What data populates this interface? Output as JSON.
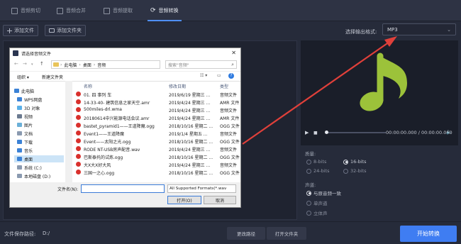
{
  "tabs": [
    {
      "label": "音频剪切",
      "icon": "scissors-icon"
    },
    {
      "label": "音频合并",
      "icon": "merge-icon"
    },
    {
      "label": "音频提取",
      "icon": "extract-icon"
    },
    {
      "label": "音频转换",
      "icon": "convert-icon",
      "active": true
    }
  ],
  "toolbar": {
    "add_file": "添加文件",
    "add_folder": "添加文件夹",
    "format_label": "选择输出格式:",
    "format_value": "MP3"
  },
  "player": {
    "time": "00:00:00.000 / 00:00:00.000",
    "accent": "#9cc23a"
  },
  "settings": {
    "quality_title": "质量:",
    "quality_options": [
      {
        "label": "8-bits",
        "selected": false
      },
      {
        "label": "16-bits",
        "selected": true
      },
      {
        "label": "24-bits",
        "selected": false
      },
      {
        "label": "32-bits",
        "selected": false
      }
    ],
    "channel_title": "声道:",
    "channel_options": [
      {
        "label": "与原音频一致",
        "selected": true
      },
      {
        "label": "单声道",
        "selected": false
      },
      {
        "label": "立体声",
        "selected": false
      }
    ]
  },
  "bottom": {
    "save_label": "文件保存路径:",
    "save_path": "D:/",
    "change_path": "更改路径",
    "open_folder": "打开文件夹",
    "start": "开始转换",
    "start_color": "#3f7df2"
  },
  "dialog": {
    "title": "请选择音频文件",
    "address": [
      "此电脑",
      "桌面",
      "音频"
    ],
    "search_placeholder": "搜索\"音频\"",
    "organize": "组织 ▾",
    "new_folder": "新建文件夹",
    "tree": [
      {
        "label": "此电脑",
        "icon": "pc-icon"
      },
      {
        "label": "WPS网盘",
        "icon": "cloud-icon"
      },
      {
        "label": "3D 对象",
        "icon": "cube-icon"
      },
      {
        "label": "视频",
        "icon": "video-icon"
      },
      {
        "label": "图片",
        "icon": "picture-icon"
      },
      {
        "label": "文档",
        "icon": "document-icon"
      },
      {
        "label": "下载",
        "icon": "download-icon"
      },
      {
        "label": "音乐",
        "icon": "music-icon"
      },
      {
        "label": "桌面",
        "icon": "desktop-icon"
      },
      {
        "label": "系统 (C:)",
        "icon": "drive-icon"
      },
      {
        "label": "本地磁盘 (D:)",
        "icon": "drive-icon"
      }
    ],
    "columns": [
      "名称",
      "修改日期",
      "类型"
    ],
    "files": [
      {
        "name": "01. 四 事列 车",
        "date": "2019/6/19 星期三 ...",
        "type": "音频文件"
      },
      {
        "name": "14-33-40- 建筑信息之家天空.amr",
        "date": "2019/4/24 星期三 ...",
        "type": "AMR 文件"
      },
      {
        "name": "500miles-drl.wma",
        "date": "2019/4/24 星期三 ...",
        "type": "音频文件"
      },
      {
        "name": "20180614中兴能源电话会议.amr",
        "date": "2019/4/24 星期三 ...",
        "type": "AMR 文件"
      },
      {
        "name": "bastet_pyramid1——王道降魔.ogg",
        "date": "2018/10/16 星期二 ...",
        "type": "OGG 文件"
      },
      {
        "name": "Event1——王道降魔",
        "date": "2019/1/4 星期五 ...",
        "type": "音频文件"
      },
      {
        "name": "Event——太阳之光.ogg",
        "date": "2018/10/16 星期二 ...",
        "type": "OGG 文件"
      },
      {
        "name": "RODE NT-USB房声配音.wav",
        "date": "2019/4/24 星期三 ...",
        "type": "音频文件"
      },
      {
        "name": "巴斯泰托的试炼.ogg",
        "date": "2018/10/16 星期二 ...",
        "type": "OGG 文件"
      },
      {
        "name": "大X大X好大风",
        "date": "2019/4/24 星期三 ...",
        "type": "音频文件"
      },
      {
        "name": "三国一之心.ogg",
        "date": "2018/10/16 星期二 ...",
        "type": "OGG 文件"
      }
    ],
    "filename_label": "文件名(N):",
    "filetype": "All Supported Formats(*.wav",
    "open": "打开(O)",
    "cancel": "取消"
  }
}
